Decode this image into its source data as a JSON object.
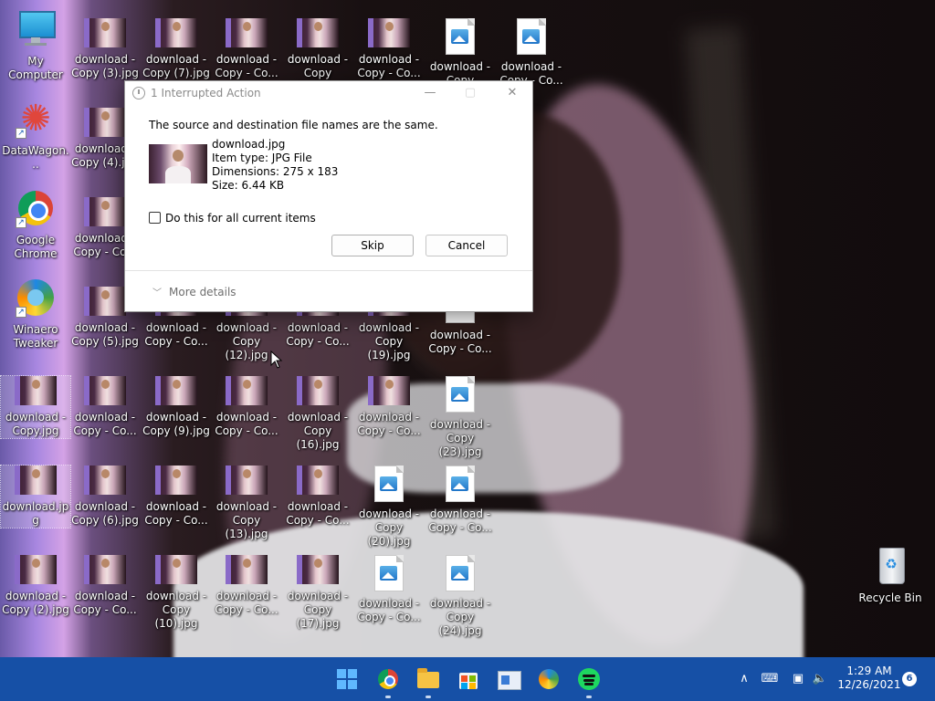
{
  "desktop": {
    "system_icons": [
      {
        "label": "My Computer"
      },
      {
        "label": "DataWagon..."
      },
      {
        "label": "Google Chrome"
      },
      {
        "label": "Winaero Tweaker"
      }
    ],
    "file_icons": [
      {
        "label": "download - Copy (3).jpg"
      },
      {
        "label": "download - Copy (7).jpg"
      },
      {
        "label": "download - Copy - Co..."
      },
      {
        "label": "download - Copy (14).jpg"
      },
      {
        "label": "download - Copy - Co..."
      },
      {
        "label": "download - Copy (21).jpg"
      },
      {
        "label": "download - Copy - Co..."
      },
      {
        "label": "download - Copy (4).jpg"
      },
      {
        "label": "download - Copy - Co..."
      },
      {
        "label": "download - Copy (5).jpg"
      },
      {
        "label": "download - Copy - Co..."
      },
      {
        "label": "download - Copy (12).jpg"
      },
      {
        "label": "download - Copy - Co..."
      },
      {
        "label": "download - Copy (19).jpg"
      },
      {
        "label": "download - Copy - Co..."
      },
      {
        "label": "download - Copy.jpg"
      },
      {
        "label": "download - Copy - Co..."
      },
      {
        "label": "download - Copy (9).jpg"
      },
      {
        "label": "download - Copy - Co..."
      },
      {
        "label": "download - Copy (16).jpg"
      },
      {
        "label": "download - Copy - Co..."
      },
      {
        "label": "download - Copy (23).jpg"
      },
      {
        "label": "download.jpg"
      },
      {
        "label": "download - Copy (6).jpg"
      },
      {
        "label": "download - Copy - Co..."
      },
      {
        "label": "download - Copy (13).jpg"
      },
      {
        "label": "download - Copy - Co..."
      },
      {
        "label": "download - Copy (20).jpg"
      },
      {
        "label": "download - Copy - Co..."
      },
      {
        "label": "download - Copy (2).jpg"
      },
      {
        "label": "download - Copy - Co..."
      },
      {
        "label": "download - Copy (10).jpg"
      },
      {
        "label": "download - Copy - Co..."
      },
      {
        "label": "download - Copy (17).jpg"
      },
      {
        "label": "download - Copy - Co..."
      },
      {
        "label": "download - Copy (24).jpg"
      }
    ],
    "recycle_bin": {
      "label": "Recycle Bin"
    }
  },
  "dialog": {
    "title": "1 Interrupted Action",
    "message": "The source and destination file names are the same.",
    "file": {
      "name": "download.jpg",
      "type": "Item type: JPG File",
      "dimensions": "Dimensions: 275 x 183",
      "size": "Size: 6.44 KB"
    },
    "checkbox_label": "Do this for all current items",
    "checkbox_checked": false,
    "skip_label": "Skip",
    "cancel_label": "Cancel",
    "more_details_label": "More details",
    "title_buttons": {
      "minimize": "—",
      "maximize": "▢",
      "close": "✕"
    }
  },
  "taskbar": {
    "color": "#1650a6",
    "apps": [
      "start-icon",
      "chrome-icon",
      "file-explorer-icon",
      "store-icon",
      "news-icon",
      "winaero-icon",
      "spotify-icon"
    ],
    "tray": {
      "chevron": "∧",
      "keyboard": "⌨",
      "network": "▣",
      "volume": "🔈"
    },
    "clock": {
      "time": "1:29 AM",
      "date": "12/26/2021"
    },
    "notification_count": "6"
  }
}
